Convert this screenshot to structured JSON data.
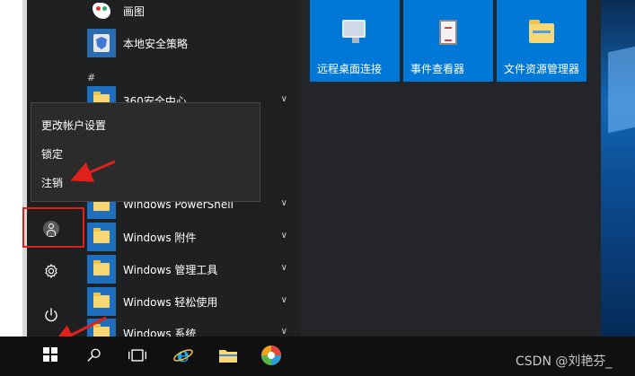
{
  "apps": [
    {
      "label": "画图",
      "icon": "paint-icon"
    },
    {
      "label": "本地安全策略",
      "icon": "local-security-policy-icon"
    },
    {
      "label": "360安全中心",
      "icon": "folder-icon",
      "expandable": true
    },
    {
      "label": "Windows PowerShell",
      "icon": "folder-icon",
      "expandable": true
    },
    {
      "label": "Windows 附件",
      "icon": "folder-icon",
      "expandable": true
    },
    {
      "label": "Windows 管理工具",
      "icon": "folder-icon",
      "expandable": true
    },
    {
      "label": "Windows 轻松使用",
      "icon": "folder-icon",
      "expandable": true
    },
    {
      "label": "Windows 系统",
      "icon": "folder-icon",
      "expandable": true
    }
  ],
  "section_letter": "#",
  "tiles": [
    {
      "label": "远程桌面连接",
      "icon": "remote-desktop-icon"
    },
    {
      "label": "事件查看器",
      "icon": "event-viewer-icon"
    },
    {
      "label": "文件资源管理器",
      "icon": "file-explorer-icon"
    }
  ],
  "account_menu": {
    "items": [
      "更改帐户设置",
      "锁定",
      "注销"
    ]
  },
  "watermark": "CSDN @刘艳芬_",
  "colors": {
    "tile_blue": "#0078d7",
    "annotation_red": "#e0201a",
    "taskbar": "#101010"
  }
}
